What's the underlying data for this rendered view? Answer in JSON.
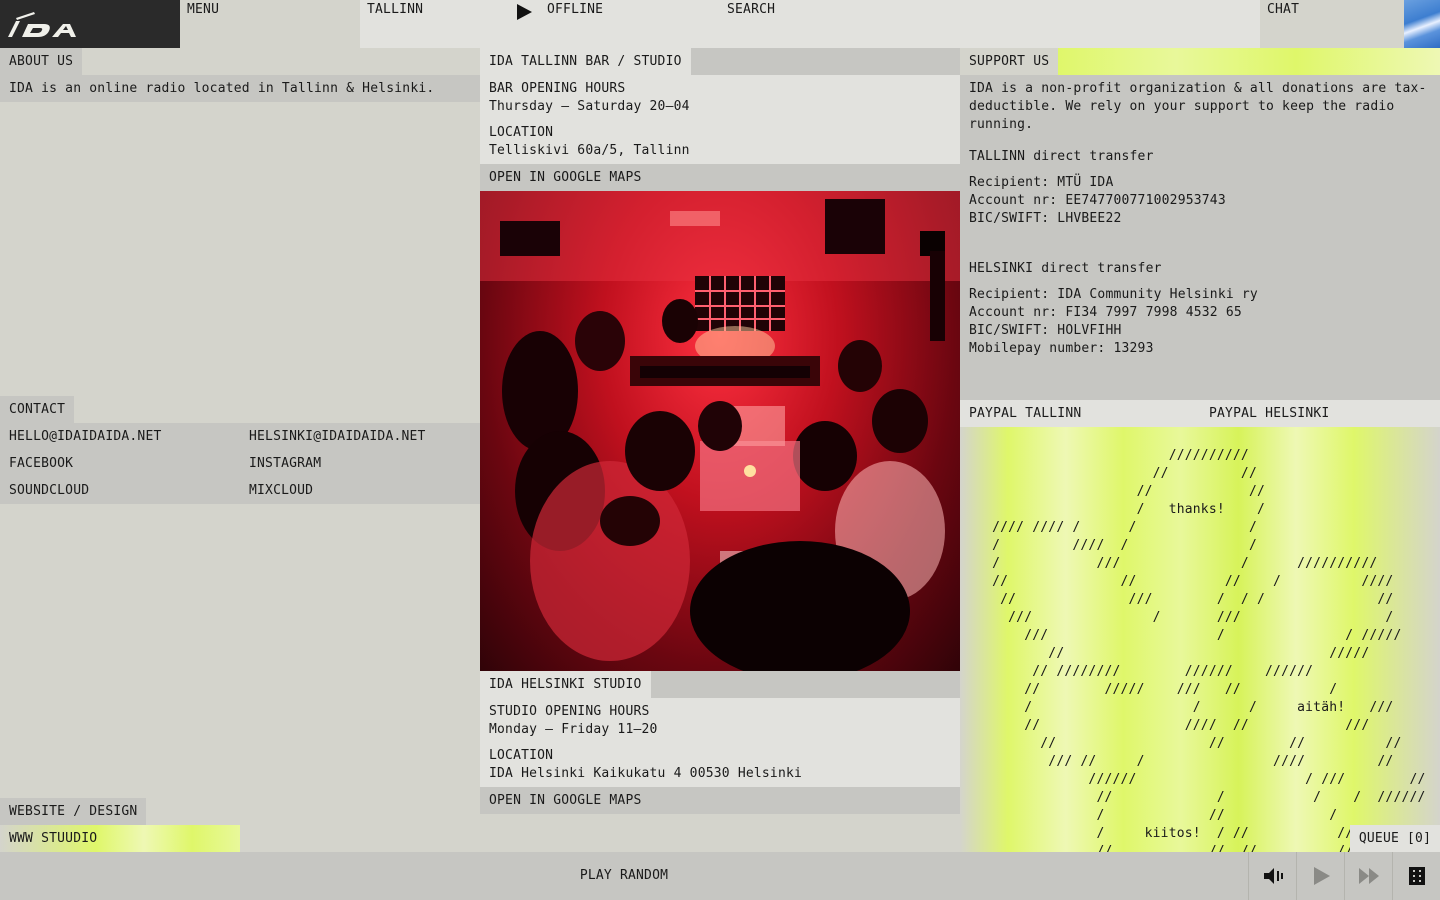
{
  "topbar": {
    "logo_text": "IDA",
    "menu_label": "MENU",
    "city_label": "TALLINN",
    "status_label": "OFFLINE",
    "search_label": "SEARCH",
    "chat_label": "CHAT"
  },
  "about": {
    "title": "ABOUT US",
    "text": "IDA is an online radio located in Tallinn & Helsinki."
  },
  "contact": {
    "title": "CONTACT",
    "links": [
      [
        "HELLO@IDAIDAIDA.NET",
        "HELSINKI@IDAIDAIDA.NET"
      ],
      [
        "FACEBOOK",
        "INSTAGRAM"
      ],
      [
        "SOUNDCLOUD",
        "MIXCLOUD"
      ]
    ]
  },
  "website": {
    "title": "WEBSITE / DESIGN",
    "credit": "WWW STUUDIO"
  },
  "tallinn_bar": {
    "title": "IDA TALLINN BAR / STUDIO",
    "hours_label": "BAR OPENING HOURS",
    "hours": "Thursday – Saturday 20–04",
    "location_label": "LOCATION",
    "location": "Telliskivi 60a/5, Tallinn",
    "maps_link": "OPEN IN GOOGLE MAPS"
  },
  "helsinki_studio": {
    "title": "IDA HELSINKI STUDIO",
    "hours_label": "STUDIO OPENING HOURS",
    "hours": "Monday – Friday 11–20",
    "location_label": "LOCATION",
    "location": "IDA Helsinki Kaikukatu 4 00530 Helsinki",
    "maps_link": "OPEN IN GOOGLE MAPS"
  },
  "support": {
    "title": "SUPPORT US",
    "intro": "IDA is a non-profit organization & all donations are tax-deductible. We rely on your support to keep the radio running.",
    "tallinn_heading": "TALLINN direct transfer",
    "tallinn_recipient": "Recipient: MTÜ IDA",
    "tallinn_account": "Account nr: EE747700771002953743",
    "tallinn_bic": "BIC/SWIFT: LHVBEE22",
    "helsinki_heading": "HELSINKI direct transfer",
    "helsinki_recipient": "Recipient: IDA Community Helsinki ry",
    "helsinki_account": "Account nr: FI34 7997 7998 4532 65",
    "helsinki_bic": "BIC/SWIFT: HOLVFIHH",
    "helsinki_mobilepay": "Mobilepay number: 13293",
    "paypal_tallinn": "PAYPAL TALLINN",
    "paypal_helsinki": "PAYPAL HELSINKI",
    "ascii_art": "                          //////////\n                        //         //\n                      //            //\n                      /   thanks!    /\n    //// //// /      /              /\n    /         ////  /               /\n    /            ///               /      //////////\n    //              //           //    /          ////\n     //              ///        /  / /              //\n      ///               /       ///                  /\n        ///                     /               / /////\n           //                                 /////\n         // ////////        //////    //////\n        //        /////    ///   //           /\n        /                    /      /     aitäh!   ///\n        //                  ////  //            ///\n          //                   //        //          //\n           /// //     /                ////         //\n                //////                     / ///        //\n                 //             /           /    /  //////\n                 /             //             /\n                 /     kiitos!  / //           //\n                 //            //  //          //"
  },
  "queue": {
    "label": "QUEUE [0]"
  },
  "player": {
    "play_random": "PLAY RANDOM"
  }
}
